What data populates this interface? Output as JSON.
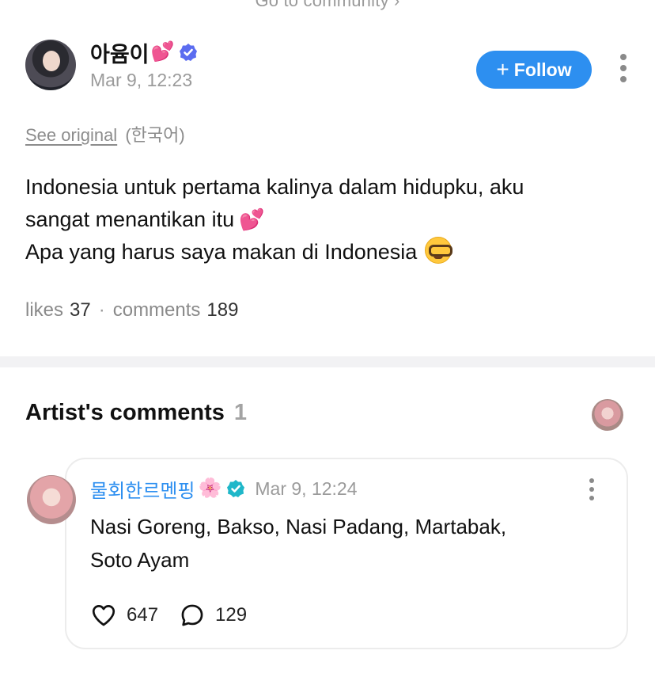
{
  "top_link": {
    "label": "Go to community"
  },
  "post": {
    "author_name": "아윰이",
    "author_emoji": "💕",
    "timestamp": "Mar 9, 12:23",
    "follow_label": "Follow",
    "see_original_label": "See original",
    "language_hint": "(한국어)",
    "body_line1": "Indonesia untuk pertama kalinya dalam hidupku, aku",
    "body_line2": "sangat menantikan itu",
    "body_line2_emoji": "💕",
    "body_line3": "Apa yang harus saya makan di Indonesia",
    "body_line3_emoji": "nerd-face",
    "likes_label": "likes",
    "likes_count": "37",
    "comments_label": "comments",
    "comments_count": "189"
  },
  "artist_comments": {
    "title": "Artist's comments",
    "count": "1",
    "items": [
      {
        "author_name": "물회한르멘핑",
        "author_emoji": "🌸",
        "timestamp": "Mar 9, 12:24",
        "text_line1": "Nasi Goreng, Bakso, Nasi Padang, Martabak,",
        "text_line2": "Soto Ayam",
        "like_count": "647",
        "reply_count": "129"
      }
    ]
  },
  "colors": {
    "accent_blue": "#2d8ff0",
    "verified_purple": "#5b6cf0",
    "verified_teal": "#1fb7c9",
    "muted_gray": "#9b9b9b"
  },
  "icons": [
    "verified-badge-icon",
    "plus-icon",
    "more-vertical-icon",
    "heart-outline-icon",
    "comment-bubble-icon"
  ]
}
